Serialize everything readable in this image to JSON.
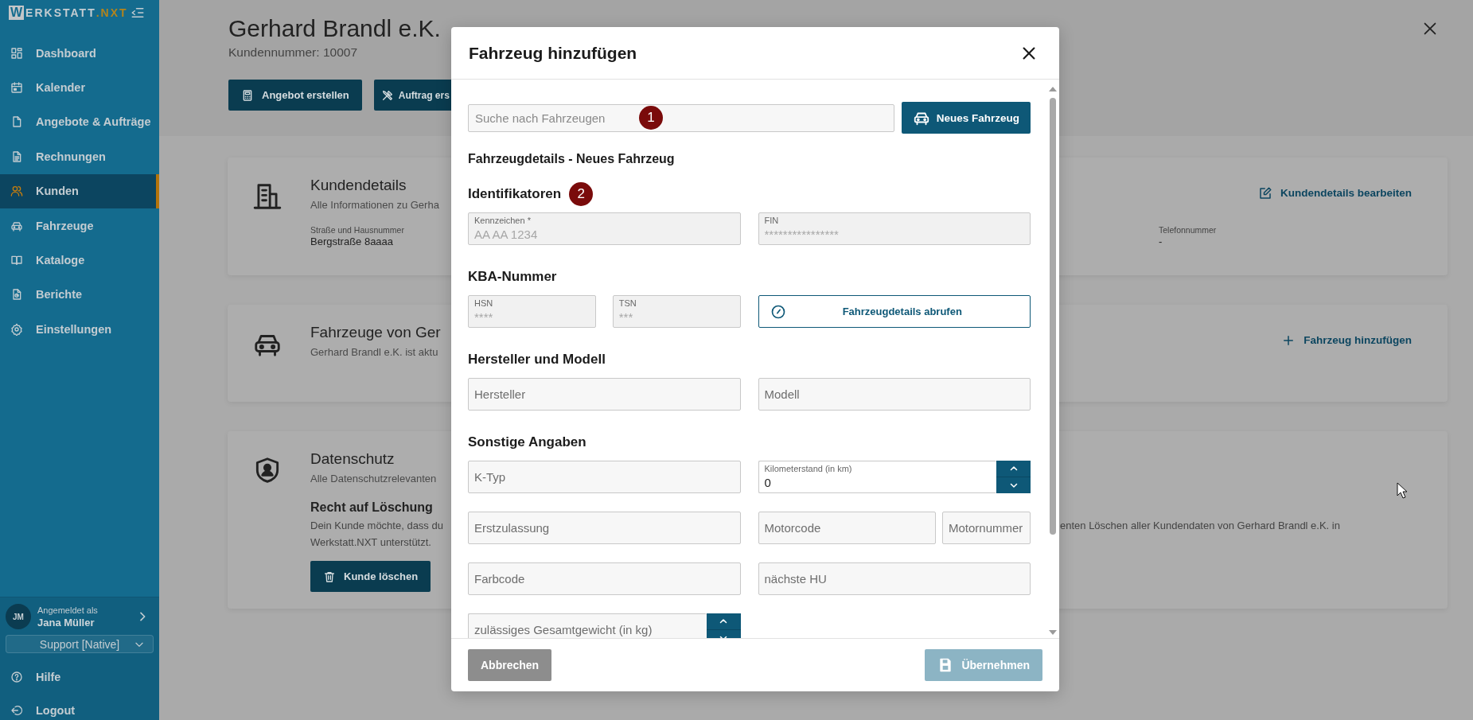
{
  "sidebar": {
    "logo": {
      "initial": "W",
      "name": "ERKSTATT",
      "suffix": ".NXT"
    },
    "items": [
      {
        "label": "Dashboard",
        "selected": false
      },
      {
        "label": "Kalender",
        "selected": false
      },
      {
        "label": "Angebote & Aufträge",
        "selected": false
      },
      {
        "label": "Rechnungen",
        "selected": false
      },
      {
        "label": "Kunden",
        "selected": true
      },
      {
        "label": "Fahrzeuge",
        "selected": false
      },
      {
        "label": "Kataloge",
        "selected": false
      },
      {
        "label": "Berichte",
        "selected": false
      },
      {
        "label": "Einstellungen",
        "selected": false
      }
    ],
    "user": {
      "initials": "JM",
      "caption": "Angemeldet als",
      "name": "Jana Müller"
    },
    "role_select": {
      "value": "Support [Native]"
    },
    "footer_items": [
      {
        "label": "Hilfe"
      },
      {
        "label": "Logout"
      }
    ]
  },
  "customer": {
    "name": "Gerhard Brandl e.K.",
    "number": "Kundennummer: 10007",
    "actions": [
      {
        "label": "Angebot erstellen"
      },
      {
        "label": "Auftrag ers"
      }
    ]
  },
  "cards": [
    {
      "title": "Kundendetails",
      "subtitle": "Alle Informationen zu Gerha",
      "fields": [
        {
          "label": "Straße und Hausnummer",
          "value": "Bergstraße 8aaaa"
        }
      ],
      "action": {
        "label": "Kundendetails bearbeiten"
      },
      "right_fields": [
        {
          "label": "Telefonnummer",
          "value": "-"
        }
      ]
    },
    {
      "title": "Fahrzeuge von Ger",
      "subtitle": "Gerhard Brandl e.K. ist aktu",
      "action": {
        "label": "Fahrzeug hinzufügen"
      }
    },
    {
      "title": "Datenschutz",
      "subtitle": "Alle Datenschutzrelevanten",
      "section_title": "Recht auf Löschung",
      "text_left": [
        "Dein Kunde möchte, dass du",
        "Werkstatt.NXT unterstützt."
      ],
      "text_right": "enten Löschen aller Kundendaten von Gerhard Brandl e.K. in",
      "button": {
        "label": "Kunde löschen"
      }
    }
  ],
  "modal": {
    "title": "Fahrzeug hinzufügen",
    "search": {
      "placeholder": "Suche nach Fahrzeugen",
      "badge": "1"
    },
    "new_button": {
      "label": "Neues Fahrzeug"
    },
    "subtitle": "Fahrzeugdetails - Neues Fahrzeug",
    "sections": [
      {
        "title": "Identifikatoren",
        "badge": "2",
        "rows": [
          {
            "left": [
              {
                "kind": "labeled",
                "label": "Kennzeichen *",
                "placeholder": "AA AA 1234"
              }
            ],
            "right": [
              {
                "kind": "labeled",
                "label": "FIN",
                "placeholder": "****************"
              }
            ]
          }
        ]
      },
      {
        "title": "KBA-Nummer",
        "rows": [
          {
            "left": [
              {
                "kind": "labeled",
                "label": "HSN",
                "placeholder": "****"
              },
              {
                "kind": "labeled",
                "label": "TSN",
                "placeholder": "***"
              }
            ],
            "right": [
              {
                "kind": "button",
                "label": "Fahrzeugdetails abrufen"
              }
            ]
          }
        ]
      },
      {
        "title": "Hersteller und Modell",
        "rows": [
          {
            "left": [
              {
                "kind": "text",
                "placeholder": "Hersteller"
              }
            ],
            "right": [
              {
                "kind": "text",
                "placeholder": "Modell"
              }
            ]
          }
        ]
      },
      {
        "title": "Sonstige Angaben",
        "rows": [
          {
            "left": [
              {
                "kind": "text",
                "placeholder": "K-Typ"
              }
            ],
            "right": [
              {
                "kind": "number",
                "label": "Kilometerstand (in km)",
                "value": "0"
              }
            ]
          },
          {
            "left": [
              {
                "kind": "text",
                "placeholder": "Erstzulassung"
              }
            ],
            "right": [
              {
                "kind": "text",
                "placeholder": "Motorcode"
              },
              {
                "kind": "text",
                "placeholder": "Motornummer"
              }
            ]
          },
          {
            "left": [
              {
                "kind": "text",
                "placeholder": "Farbcode"
              }
            ],
            "right": [
              {
                "kind": "text",
                "placeholder": "nächste HU"
              }
            ]
          },
          {
            "left": [
              {
                "kind": "number",
                "placeholder": "zulässiges Gesamtgewicht (in kg)"
              }
            ]
          }
        ]
      }
    ],
    "buttons": [
      {
        "label": "Abbrechen",
        "kind": "secondary",
        "disabled": false
      },
      {
        "label": "Übernehmen",
        "kind": "primary",
        "disabled": true
      }
    ]
  }
}
